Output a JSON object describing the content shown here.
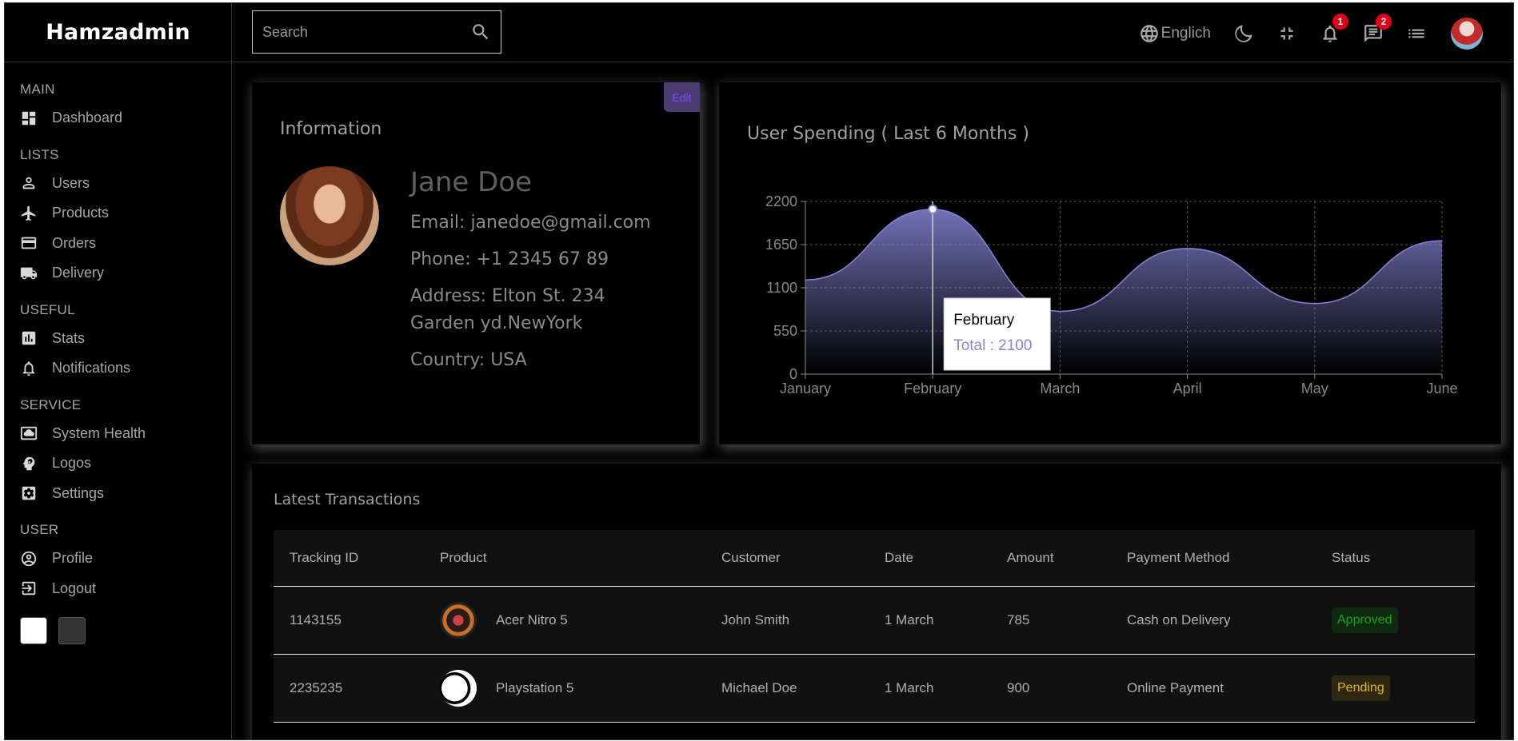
{
  "app": {
    "title": "Hamzadmin"
  },
  "sidebar": {
    "sections": [
      {
        "title": "MAIN",
        "items": [
          {
            "label": "Dashboard",
            "icon": "dashboard-icon"
          }
        ]
      },
      {
        "title": "LISTS",
        "items": [
          {
            "label": "Users",
            "icon": "user-icon"
          },
          {
            "label": "Products",
            "icon": "airplane-icon"
          },
          {
            "label": "Orders",
            "icon": "credit-card-icon"
          },
          {
            "label": "Delivery",
            "icon": "truck-icon"
          }
        ]
      },
      {
        "title": "USEFUL",
        "items": [
          {
            "label": "Stats",
            "icon": "bar-chart-icon"
          },
          {
            "label": "Notifications",
            "icon": "bell-icon"
          }
        ]
      },
      {
        "title": "SERVICE",
        "items": [
          {
            "label": "System Health",
            "icon": "cloud-icon"
          },
          {
            "label": "Logos",
            "icon": "psychology-icon"
          },
          {
            "label": "Settings",
            "icon": "settings-icon"
          }
        ]
      },
      {
        "title": "USER",
        "items": [
          {
            "label": "Profile",
            "icon": "account-circle-icon"
          },
          {
            "label": "Logout",
            "icon": "logout-icon"
          }
        ]
      }
    ]
  },
  "navbar": {
    "search_placeholder": "Search",
    "language": "Englich",
    "notifications_count": "1",
    "messages_count": "2"
  },
  "info": {
    "title": "Information",
    "edit_label": "Edit",
    "name": "Jane Doe",
    "email": "Email: janedoe@gmail.com",
    "phone": "Phone: +1 2345 67 89",
    "address": "Address: Elton St. 234 Garden yd.NewYork",
    "country": "Country: USA"
  },
  "chart_data": {
    "type": "area",
    "title": "User Spending ( Last 6 Months )",
    "categories": [
      "January",
      "February",
      "March",
      "April",
      "May",
      "June"
    ],
    "series": [
      {
        "name": "Total",
        "values": [
          1200,
          2100,
          800,
          1600,
          900,
          1700
        ]
      }
    ],
    "ylim": [
      0,
      2200
    ],
    "yticks": [
      0,
      550,
      1100,
      1650,
      2200
    ],
    "grid": true,
    "line_color": "#8884d8",
    "tooltip": {
      "label": "February",
      "text": "Total : 2100"
    }
  },
  "transactions": {
    "title": "Latest Transactions",
    "columns": [
      "Tracking ID",
      "Product",
      "Customer",
      "Date",
      "Amount",
      "Payment Method",
      "Status"
    ],
    "rows": [
      {
        "id": "1143155",
        "product": "Acer Nitro 5",
        "customer": "John Smith",
        "date": "1 March",
        "amount": "785",
        "method": "Cash on Delivery",
        "status": "Approved"
      },
      {
        "id": "2235235",
        "product": "Playstation 5",
        "customer": "Michael Doe",
        "date": "1 March",
        "amount": "900",
        "method": "Online Payment",
        "status": "Pending"
      }
    ]
  }
}
